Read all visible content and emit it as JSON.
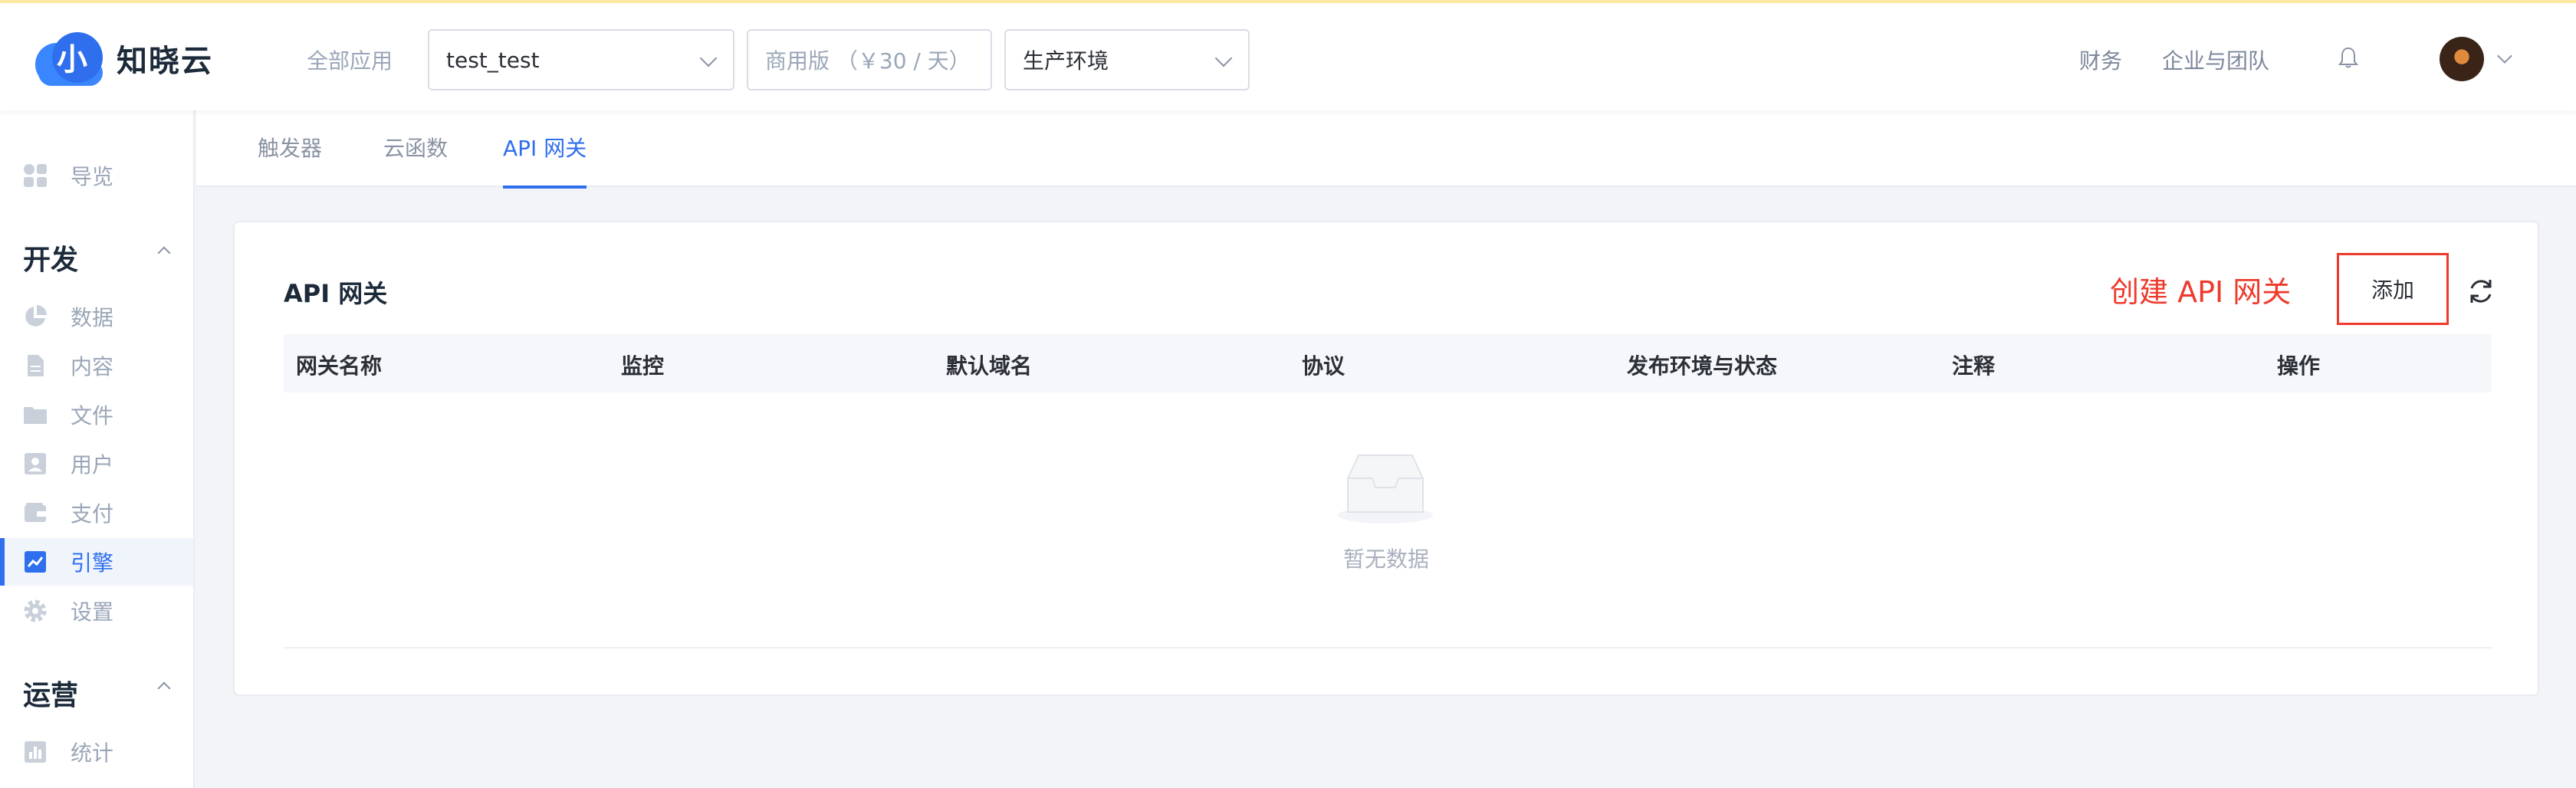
{
  "brand": {
    "name": "知晓云"
  },
  "topbar": {
    "all_apps": "全部应用",
    "app_select": "test_test",
    "plan_select": "商用版 （￥30 / 天）",
    "env_select": "生产环境",
    "links": [
      "财务",
      "企业与团队"
    ]
  },
  "sidebar": {
    "overview": "导览",
    "dev_section": "开发",
    "dev_items": [
      "数据",
      "内容",
      "文件",
      "用户",
      "支付",
      "引擎",
      "设置"
    ],
    "ops_section": "运营",
    "ops_items": [
      "统计"
    ]
  },
  "tabs": [
    "触发器",
    "云函数",
    "API 网关"
  ],
  "card": {
    "title": "API 网关",
    "annotation": "创建 API 网关",
    "add_label": "添加",
    "columns": [
      "网关名称",
      "监控",
      "默认域名",
      "协议",
      "发布环境与状态",
      "注释",
      "操作"
    ],
    "empty_text": "暂无数据"
  },
  "colors": {
    "accent": "#2f6fee",
    "annotation": "#ee3a2c"
  },
  "icons": [
    "dashboard-icon",
    "pie-chart-icon",
    "document-icon",
    "folder-icon",
    "user-icon",
    "wallet-icon",
    "line-chart-icon",
    "gear-icon",
    "bar-chart-icon",
    "bell-icon",
    "refresh-icon",
    "inbox-icon"
  ]
}
